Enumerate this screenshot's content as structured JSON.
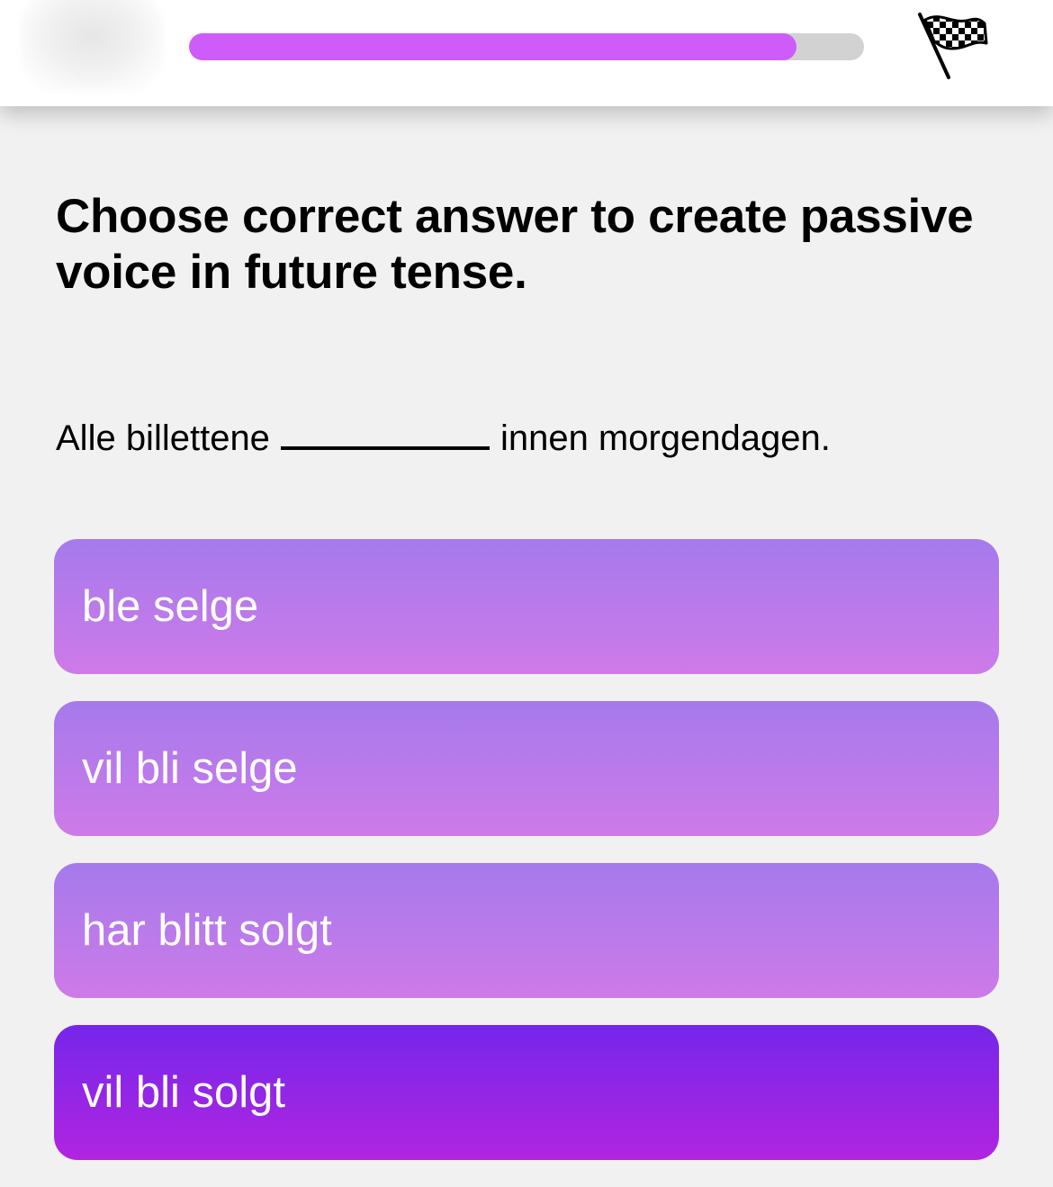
{
  "header": {
    "progress_percent": 90,
    "progress_fill_color": "#cd5cfb",
    "progress_track_color": "#d2d2d2",
    "finish_icon": "checkered-flag-icon"
  },
  "question": {
    "instruction": "Choose correct answer to create passive voice in future tense.",
    "sentence_before": "Alle billettene",
    "sentence_after": "innen morgendagen."
  },
  "options": [
    {
      "label": "ble selge",
      "selected": false
    },
    {
      "label": "vil bli selge",
      "selected": false
    },
    {
      "label": "har blitt solgt",
      "selected": false
    },
    {
      "label": "vil bli solgt",
      "selected": true
    }
  ],
  "colors": {
    "option_gradient": [
      "#a57aec",
      "#ce7ae8"
    ],
    "selected_gradient": [
      "#7526ea",
      "#b125e1"
    ],
    "background": "#f1f1f1"
  }
}
